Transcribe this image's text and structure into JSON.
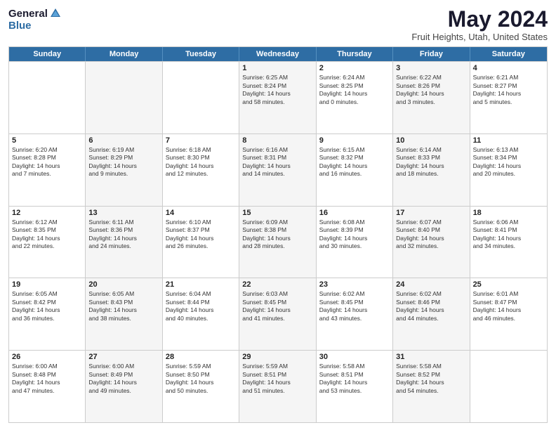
{
  "header": {
    "logo_general": "General",
    "logo_blue": "Blue",
    "title": "May 2024",
    "subtitle": "Fruit Heights, Utah, United States"
  },
  "days_of_week": [
    "Sunday",
    "Monday",
    "Tuesday",
    "Wednesday",
    "Thursday",
    "Friday",
    "Saturday"
  ],
  "weeks": [
    [
      {
        "day": "",
        "lines": [],
        "alt": false
      },
      {
        "day": "",
        "lines": [],
        "alt": true
      },
      {
        "day": "",
        "lines": [],
        "alt": false
      },
      {
        "day": "1",
        "lines": [
          "Sunrise: 6:25 AM",
          "Sunset: 8:24 PM",
          "Daylight: 14 hours",
          "and 58 minutes."
        ],
        "alt": true
      },
      {
        "day": "2",
        "lines": [
          "Sunrise: 6:24 AM",
          "Sunset: 8:25 PM",
          "Daylight: 14 hours",
          "and 0 minutes."
        ],
        "alt": false
      },
      {
        "day": "3",
        "lines": [
          "Sunrise: 6:22 AM",
          "Sunset: 8:26 PM",
          "Daylight: 14 hours",
          "and 3 minutes."
        ],
        "alt": true
      },
      {
        "day": "4",
        "lines": [
          "Sunrise: 6:21 AM",
          "Sunset: 8:27 PM",
          "Daylight: 14 hours",
          "and 5 minutes."
        ],
        "alt": false
      }
    ],
    [
      {
        "day": "5",
        "lines": [
          "Sunrise: 6:20 AM",
          "Sunset: 8:28 PM",
          "Daylight: 14 hours",
          "and 7 minutes."
        ],
        "alt": false
      },
      {
        "day": "6",
        "lines": [
          "Sunrise: 6:19 AM",
          "Sunset: 8:29 PM",
          "Daylight: 14 hours",
          "and 9 minutes."
        ],
        "alt": true
      },
      {
        "day": "7",
        "lines": [
          "Sunrise: 6:18 AM",
          "Sunset: 8:30 PM",
          "Daylight: 14 hours",
          "and 12 minutes."
        ],
        "alt": false
      },
      {
        "day": "8",
        "lines": [
          "Sunrise: 6:16 AM",
          "Sunset: 8:31 PM",
          "Daylight: 14 hours",
          "and 14 minutes."
        ],
        "alt": true
      },
      {
        "day": "9",
        "lines": [
          "Sunrise: 6:15 AM",
          "Sunset: 8:32 PM",
          "Daylight: 14 hours",
          "and 16 minutes."
        ],
        "alt": false
      },
      {
        "day": "10",
        "lines": [
          "Sunrise: 6:14 AM",
          "Sunset: 8:33 PM",
          "Daylight: 14 hours",
          "and 18 minutes."
        ],
        "alt": true
      },
      {
        "day": "11",
        "lines": [
          "Sunrise: 6:13 AM",
          "Sunset: 8:34 PM",
          "Daylight: 14 hours",
          "and 20 minutes."
        ],
        "alt": false
      }
    ],
    [
      {
        "day": "12",
        "lines": [
          "Sunrise: 6:12 AM",
          "Sunset: 8:35 PM",
          "Daylight: 14 hours",
          "and 22 minutes."
        ],
        "alt": false
      },
      {
        "day": "13",
        "lines": [
          "Sunrise: 6:11 AM",
          "Sunset: 8:36 PM",
          "Daylight: 14 hours",
          "and 24 minutes."
        ],
        "alt": true
      },
      {
        "day": "14",
        "lines": [
          "Sunrise: 6:10 AM",
          "Sunset: 8:37 PM",
          "Daylight: 14 hours",
          "and 26 minutes."
        ],
        "alt": false
      },
      {
        "day": "15",
        "lines": [
          "Sunrise: 6:09 AM",
          "Sunset: 8:38 PM",
          "Daylight: 14 hours",
          "and 28 minutes."
        ],
        "alt": true
      },
      {
        "day": "16",
        "lines": [
          "Sunrise: 6:08 AM",
          "Sunset: 8:39 PM",
          "Daylight: 14 hours",
          "and 30 minutes."
        ],
        "alt": false
      },
      {
        "day": "17",
        "lines": [
          "Sunrise: 6:07 AM",
          "Sunset: 8:40 PM",
          "Daylight: 14 hours",
          "and 32 minutes."
        ],
        "alt": true
      },
      {
        "day": "18",
        "lines": [
          "Sunrise: 6:06 AM",
          "Sunset: 8:41 PM",
          "Daylight: 14 hours",
          "and 34 minutes."
        ],
        "alt": false
      }
    ],
    [
      {
        "day": "19",
        "lines": [
          "Sunrise: 6:05 AM",
          "Sunset: 8:42 PM",
          "Daylight: 14 hours",
          "and 36 minutes."
        ],
        "alt": false
      },
      {
        "day": "20",
        "lines": [
          "Sunrise: 6:05 AM",
          "Sunset: 8:43 PM",
          "Daylight: 14 hours",
          "and 38 minutes."
        ],
        "alt": true
      },
      {
        "day": "21",
        "lines": [
          "Sunrise: 6:04 AM",
          "Sunset: 8:44 PM",
          "Daylight: 14 hours",
          "and 40 minutes."
        ],
        "alt": false
      },
      {
        "day": "22",
        "lines": [
          "Sunrise: 6:03 AM",
          "Sunset: 8:45 PM",
          "Daylight: 14 hours",
          "and 41 minutes."
        ],
        "alt": true
      },
      {
        "day": "23",
        "lines": [
          "Sunrise: 6:02 AM",
          "Sunset: 8:45 PM",
          "Daylight: 14 hours",
          "and 43 minutes."
        ],
        "alt": false
      },
      {
        "day": "24",
        "lines": [
          "Sunrise: 6:02 AM",
          "Sunset: 8:46 PM",
          "Daylight: 14 hours",
          "and 44 minutes."
        ],
        "alt": true
      },
      {
        "day": "25",
        "lines": [
          "Sunrise: 6:01 AM",
          "Sunset: 8:47 PM",
          "Daylight: 14 hours",
          "and 46 minutes."
        ],
        "alt": false
      }
    ],
    [
      {
        "day": "26",
        "lines": [
          "Sunrise: 6:00 AM",
          "Sunset: 8:48 PM",
          "Daylight: 14 hours",
          "and 47 minutes."
        ],
        "alt": false
      },
      {
        "day": "27",
        "lines": [
          "Sunrise: 6:00 AM",
          "Sunset: 8:49 PM",
          "Daylight: 14 hours",
          "and 49 minutes."
        ],
        "alt": true
      },
      {
        "day": "28",
        "lines": [
          "Sunrise: 5:59 AM",
          "Sunset: 8:50 PM",
          "Daylight: 14 hours",
          "and 50 minutes."
        ],
        "alt": false
      },
      {
        "day": "29",
        "lines": [
          "Sunrise: 5:59 AM",
          "Sunset: 8:51 PM",
          "Daylight: 14 hours",
          "and 51 minutes."
        ],
        "alt": true
      },
      {
        "day": "30",
        "lines": [
          "Sunrise: 5:58 AM",
          "Sunset: 8:51 PM",
          "Daylight: 14 hours",
          "and 53 minutes."
        ],
        "alt": false
      },
      {
        "day": "31",
        "lines": [
          "Sunrise: 5:58 AM",
          "Sunset: 8:52 PM",
          "Daylight: 14 hours",
          "and 54 minutes."
        ],
        "alt": true
      },
      {
        "day": "",
        "lines": [],
        "alt": false
      }
    ]
  ]
}
